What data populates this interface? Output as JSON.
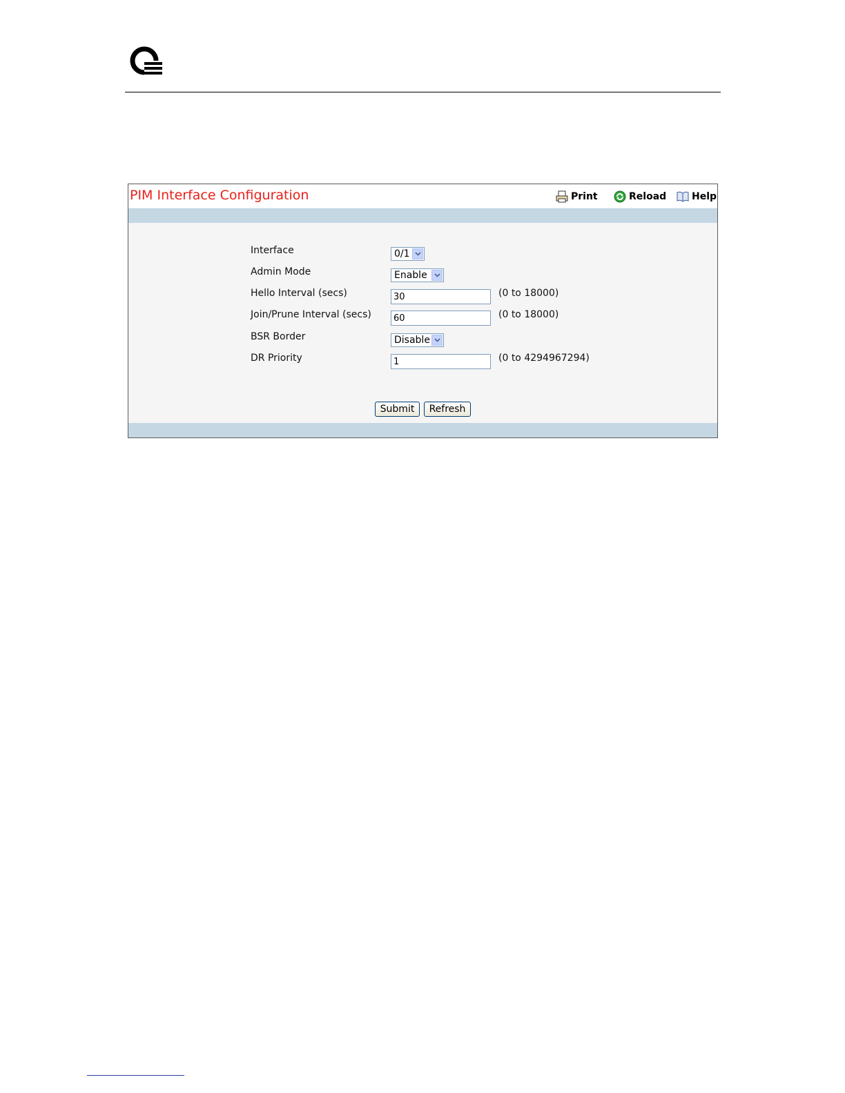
{
  "header": {
    "logo_icon": "qlogic-q-logo-icon"
  },
  "panel": {
    "title": "PIM Interface Configuration",
    "title_color": "#e8201a",
    "band_color": "#c4d7e3",
    "toolbar": {
      "print": "Print",
      "reload": "Reload",
      "help": "Help"
    }
  },
  "form": {
    "interface": {
      "label": "Interface",
      "value": "0/1"
    },
    "admin_mode": {
      "label": "Admin Mode",
      "value": "Enable"
    },
    "hello_interval": {
      "label": "Hello Interval (secs)",
      "value": "30",
      "range": "(0 to 18000)"
    },
    "join_prune_interval": {
      "label": "Join/Prune Interval (secs)",
      "value": "60",
      "range": "(0 to 18000)"
    },
    "bsr_border": {
      "label": "BSR Border",
      "value": "Disable"
    },
    "dr_priority": {
      "label": "DR Priority",
      "value": "1",
      "range": "(0 to 4294967294)"
    }
  },
  "buttons": {
    "submit": "Submit",
    "refresh": "Refresh"
  }
}
